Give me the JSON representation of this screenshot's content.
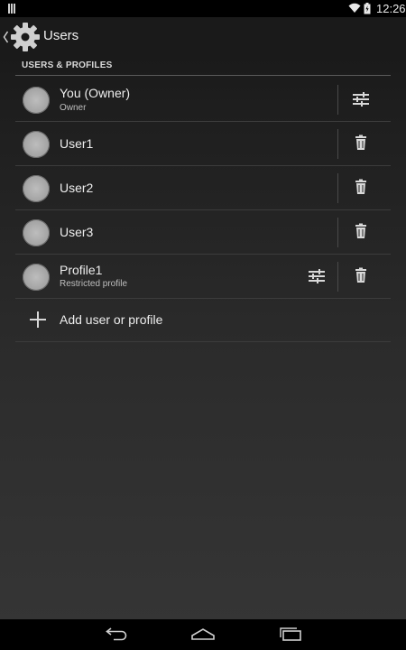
{
  "status": {
    "time": "12:26"
  },
  "header": {
    "title": "Users"
  },
  "section": {
    "title": "USERS & PROFILES"
  },
  "users": [
    {
      "name": "You (Owner)",
      "subtitle": "Owner",
      "settings": true,
      "delete": false
    },
    {
      "name": "User1",
      "subtitle": "",
      "settings": false,
      "delete": true
    },
    {
      "name": "User2",
      "subtitle": "",
      "settings": false,
      "delete": true
    },
    {
      "name": "User3",
      "subtitle": "",
      "settings": false,
      "delete": true
    },
    {
      "name": "Profile1",
      "subtitle": "Restricted profile",
      "settings": true,
      "delete": true
    }
  ],
  "add": {
    "label": "Add user or profile"
  },
  "icons": {
    "status_left": "notification-icon",
    "wifi": "wifi-icon",
    "battery": "battery-icon",
    "back": "chevron-left-icon",
    "app": "gear-icon",
    "settings": "sliders-icon",
    "delete": "trash-icon",
    "add": "plus-icon",
    "nav_back": "back-icon",
    "nav_home": "home-icon",
    "nav_recents": "recents-icon"
  },
  "colors": {
    "background": "#1f1f1f",
    "text": "#eeeeee",
    "divider": "#3c3c3c"
  }
}
